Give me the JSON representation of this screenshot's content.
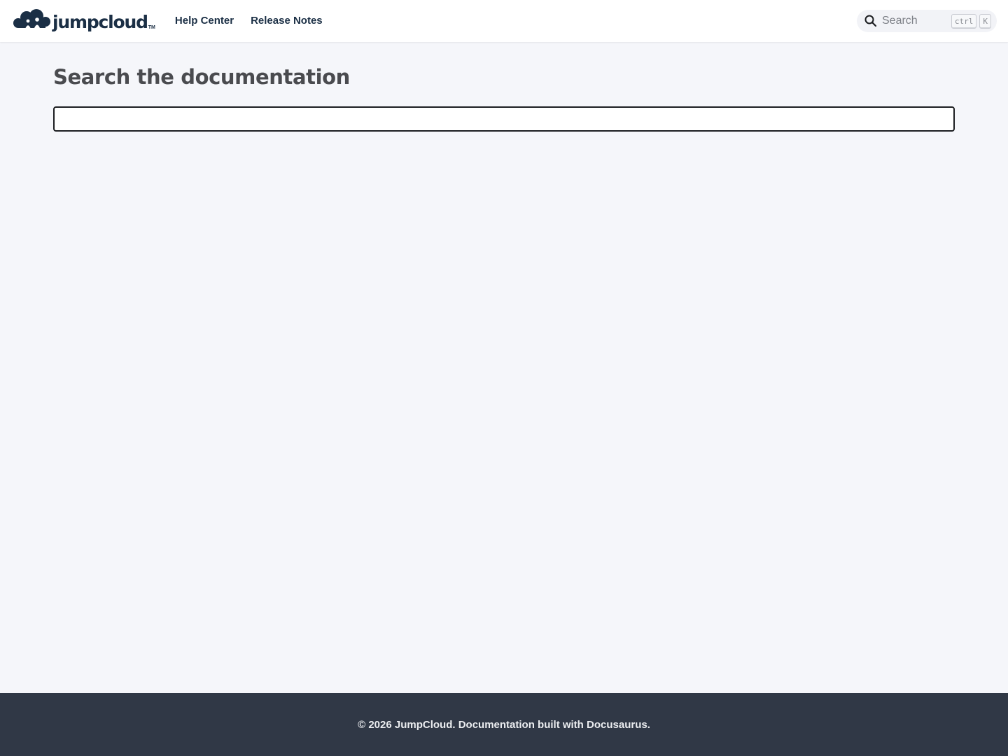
{
  "navbar": {
    "brand": {
      "text": "jumpcloud",
      "trademark": "TM",
      "logo_icon": "jumpcloud-cloud-logo-icon"
    },
    "links": [
      {
        "label": "Help Center"
      },
      {
        "label": "Release Notes"
      }
    ],
    "search": {
      "placeholder": "Search",
      "shortcut_keys": [
        "ctrl",
        "K"
      ],
      "icon": "search-icon"
    }
  },
  "main": {
    "title": "Search the documentation",
    "search_input": {
      "value": "",
      "placeholder": ""
    }
  },
  "footer": {
    "copyright": "© 2026 JumpCloud. Documentation built with Docusaurus."
  },
  "colors": {
    "navbar_bg": "#ffffff",
    "page_bg": "#f5f6fa",
    "brand_text": "#1b2f45",
    "title_text": "#4a4b4f",
    "footer_bg": "#303846",
    "footer_text": "#ebedf0"
  }
}
